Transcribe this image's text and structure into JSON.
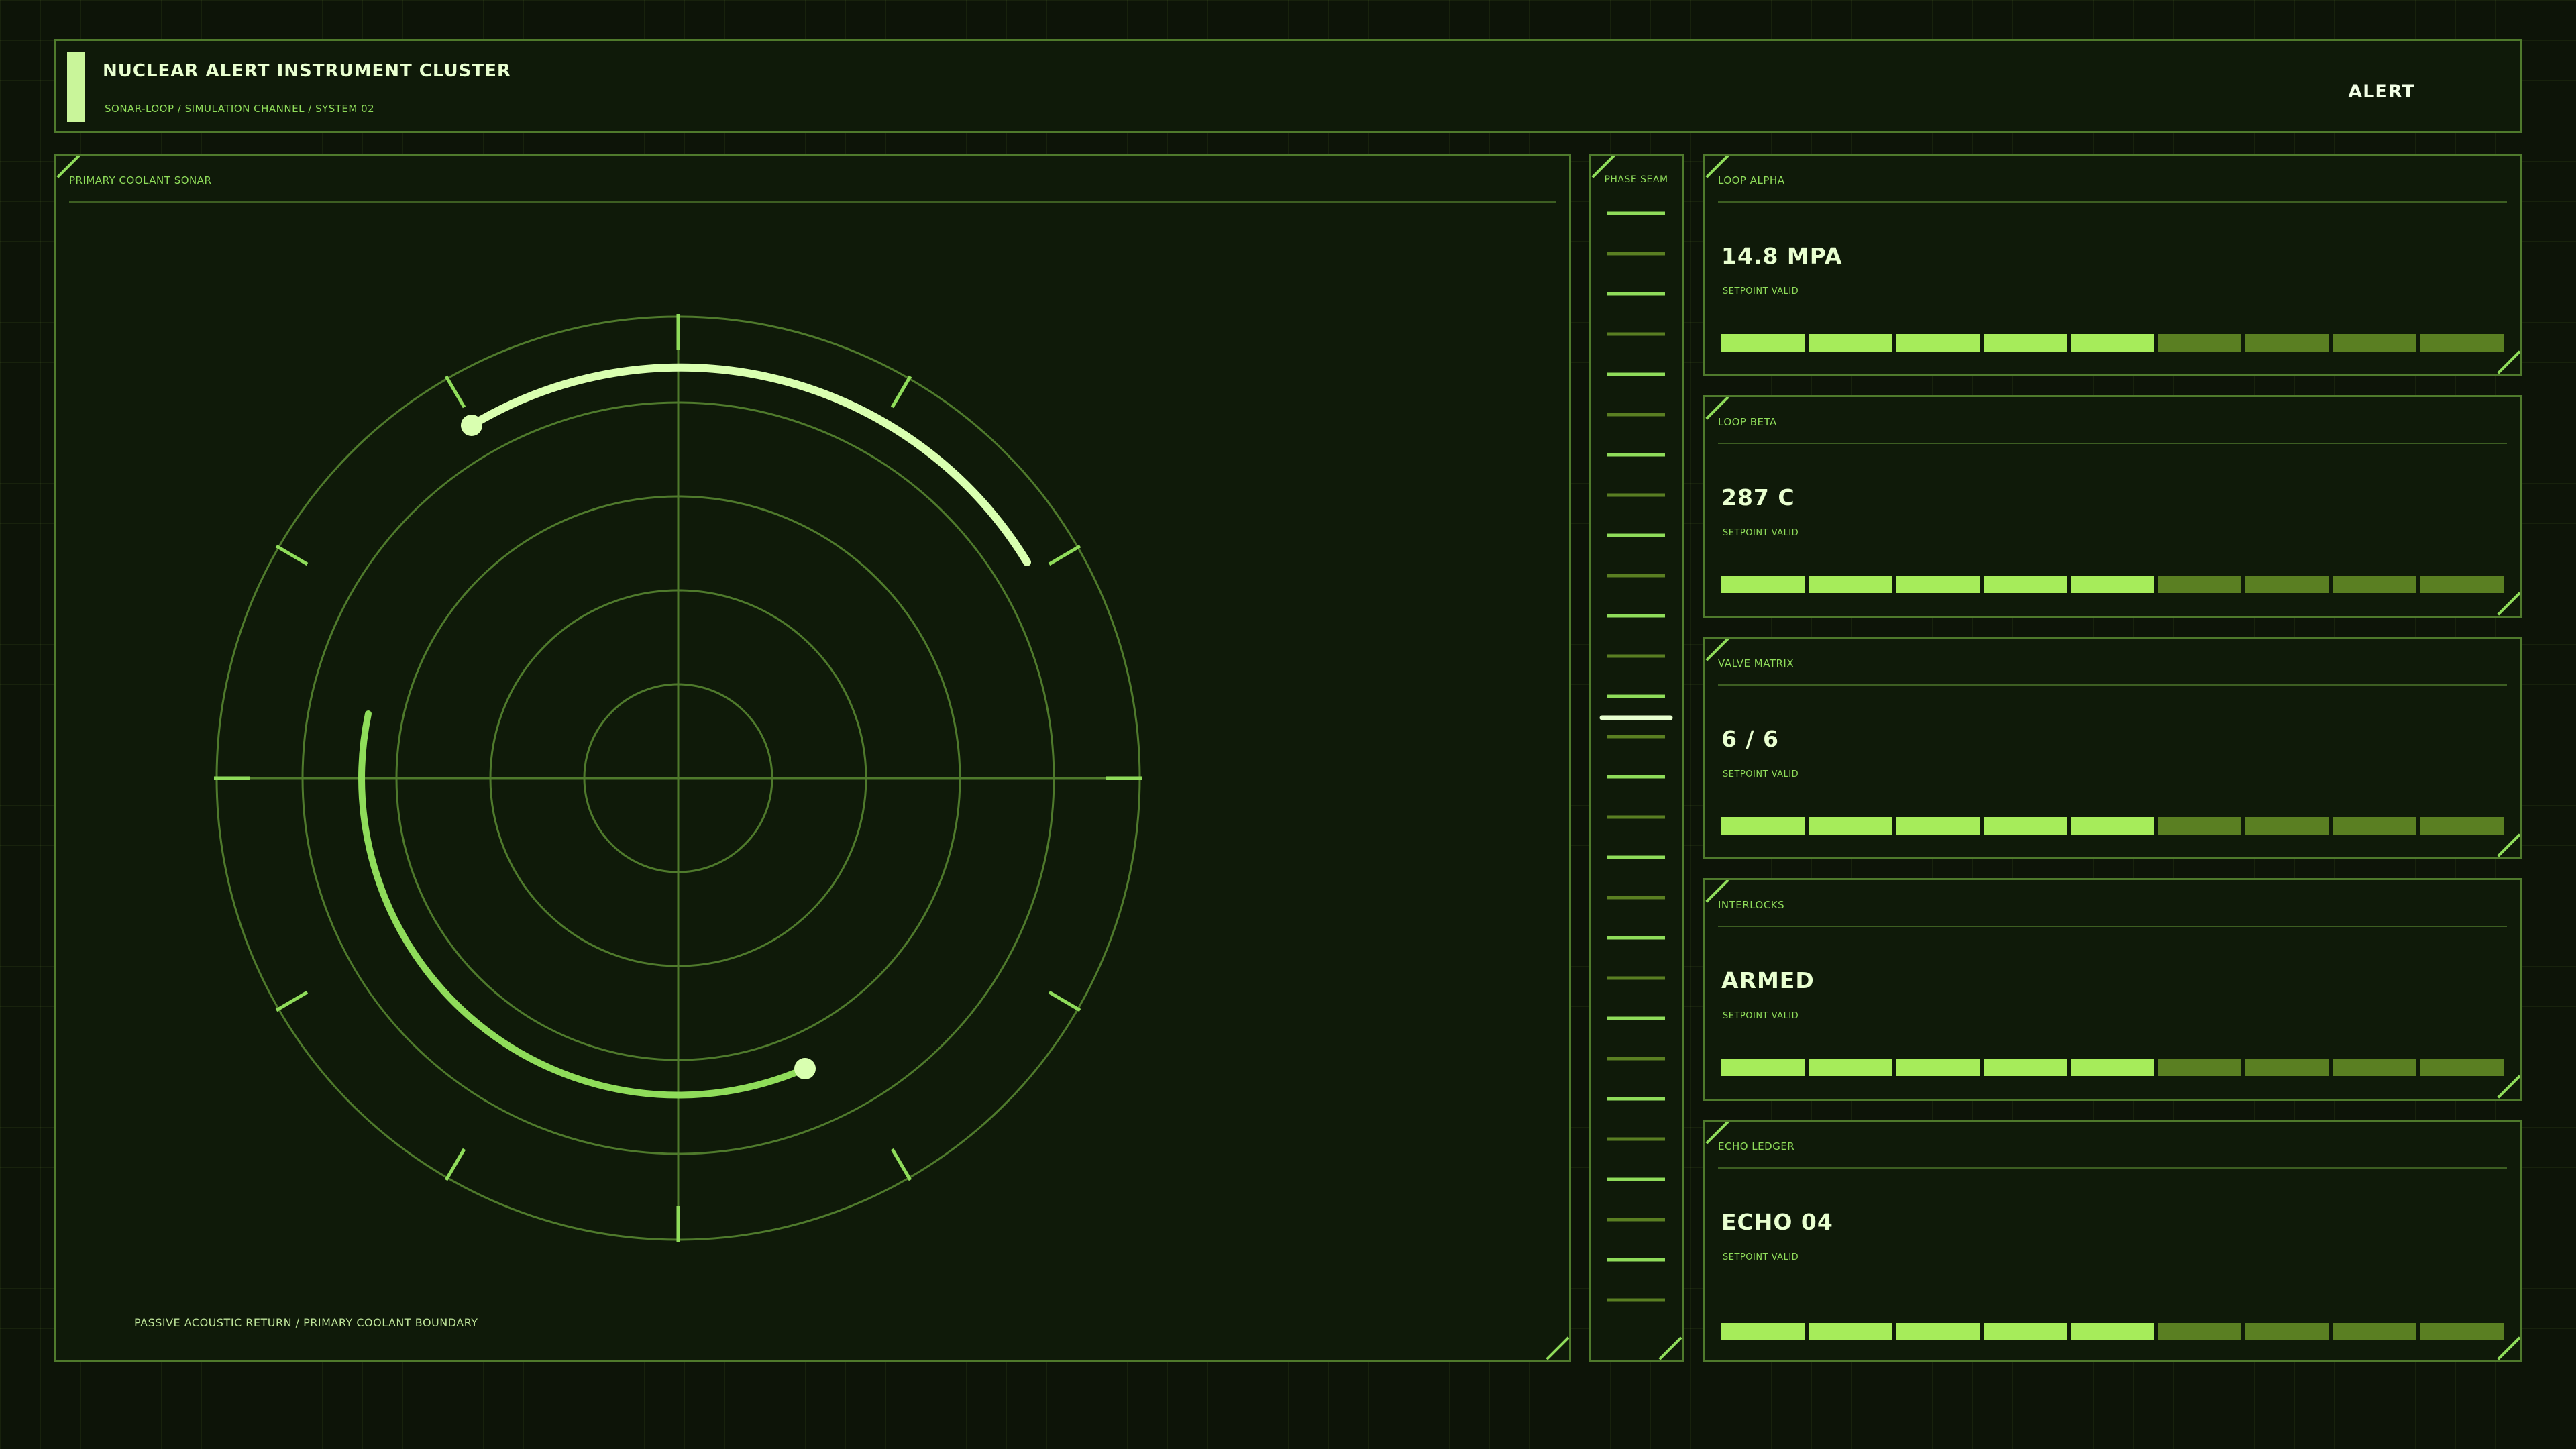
{
  "header": {
    "title": "NUCLEAR ALERT INSTRUMENT CLUSTER",
    "subtitle": "SONAR-LOOP / SIMULATION CHANNEL / SYSTEM 02",
    "alert": "ALERT"
  },
  "sonar": {
    "label": "PRIMARY COOLANT SONAR",
    "footer": "PASSIVE ACOUSTIC RETURN / PRIMARY COOLANT BOUNDARY"
  },
  "phase_seam": {
    "label": "PHASE SEAM"
  },
  "gauges": [
    {
      "label": "LOOP ALPHA",
      "value": "14.8 MPA",
      "status": "SETPOINT VALID",
      "segments_total": 9,
      "segments_lit": 5
    },
    {
      "label": "LOOP BETA",
      "value": "287 C",
      "status": "SETPOINT VALID",
      "segments_total": 9,
      "segments_lit": 5
    },
    {
      "label": "VALVE MATRIX",
      "value": "6 / 6",
      "status": "SETPOINT VALID",
      "segments_total": 9,
      "segments_lit": 5
    },
    {
      "label": "INTERLOCKS",
      "value": "ARMED",
      "status": "SETPOINT VALID",
      "segments_total": 9,
      "segments_lit": 5
    },
    {
      "label": "ECHO LEDGER",
      "value": "ECHO 04",
      "status": "SETPOINT VALID",
      "segments_total": 9,
      "segments_lit": 5
    }
  ],
  "colors": {
    "accent": "#a6ec5a",
    "accent_dim": "#5a7f22",
    "highlight": "#d9ffb0",
    "line": "#4f7a2c",
    "background": "#0d1408"
  }
}
